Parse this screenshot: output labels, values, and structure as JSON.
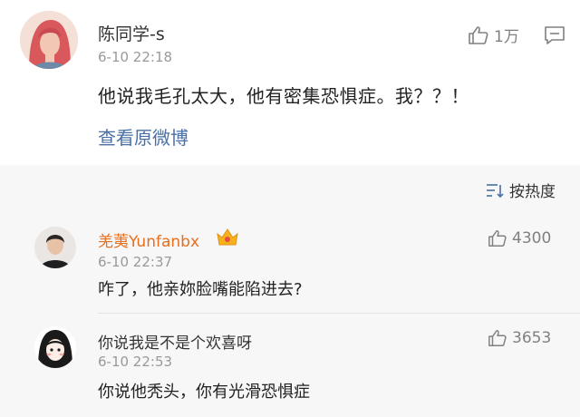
{
  "post": {
    "username": "陈同学-s",
    "time": "6-10 22:18",
    "like_count": "1万",
    "text": "他说我毛孔太大，他有密集恐惧症。我？？！",
    "view_original": "查看原微博"
  },
  "sort": {
    "label": "按热度"
  },
  "comments": [
    {
      "username": "羌荑Yunfanbx",
      "time": "6-10 22:37",
      "text": "咋了，他亲妳脸嘴能陷进去?",
      "like_count": "4300"
    },
    {
      "username": "你说我是不是个欢喜呀",
      "time": "6-10 22:53",
      "text": "你说他秃头，你有光滑恐惧症",
      "like_count": "3653"
    }
  ],
  "colors": {
    "link": "#4a6fa5",
    "vip_name": "#e86e1e",
    "muted": "#999999",
    "background_gray": "#f7f7f7"
  },
  "icons": [
    "thumbs-up-icon",
    "comment-icon",
    "sort-icon",
    "vip-crown-icon"
  ]
}
